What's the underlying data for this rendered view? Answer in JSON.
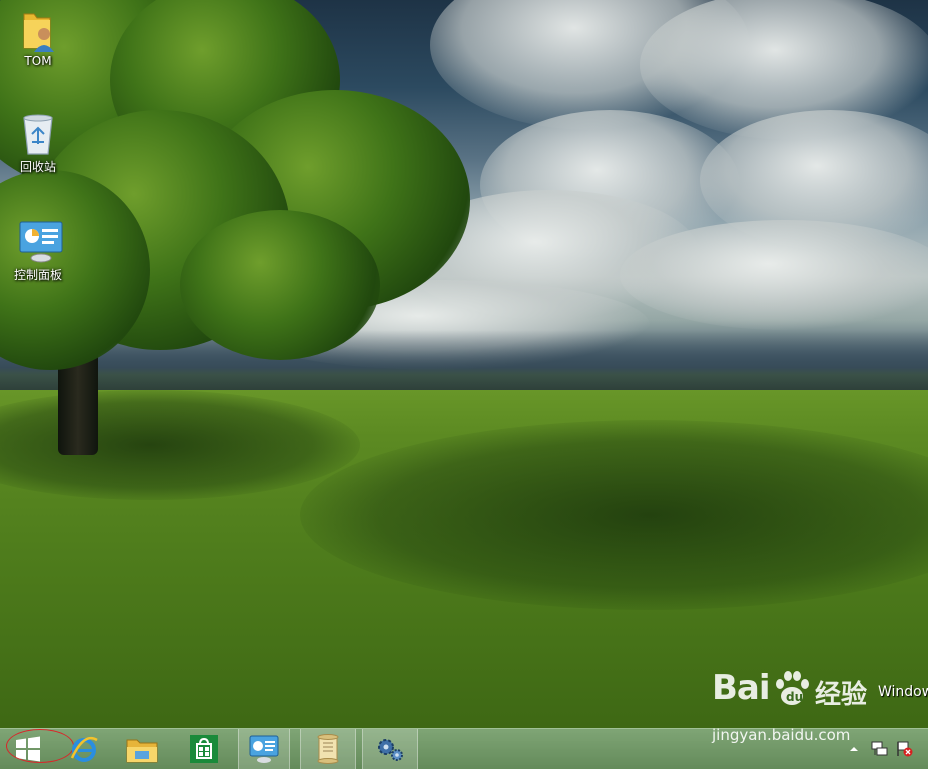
{
  "desktop": {
    "icons": [
      {
        "label": "TOM",
        "icon": "user-folder-icon"
      },
      {
        "label": "回收站",
        "icon": "recycle-bin-icon"
      },
      {
        "label": "控制面板",
        "icon": "control-panel-icon"
      }
    ],
    "windows_text": "Windows"
  },
  "watermark": {
    "brand": "Bai",
    "brand_cn": "经验",
    "url": "jingyan.baidu.com"
  },
  "taskbar": {
    "buttons": [
      {
        "name": "start-button",
        "icon": "windows-logo-icon"
      },
      {
        "name": "internet-explorer",
        "icon": "ie-icon"
      },
      {
        "name": "file-explorer",
        "icon": "folder-icon"
      },
      {
        "name": "windows-store",
        "icon": "store-icon"
      },
      {
        "name": "control-panel",
        "icon": "control-panel-icon"
      },
      {
        "name": "notepad-scroll",
        "icon": "scroll-icon"
      },
      {
        "name": "settings",
        "icon": "gear-icon"
      }
    ],
    "tray": [
      "chevron-up-icon",
      "network-icon",
      "flag-icon"
    ],
    "colors": {
      "start_highlight": "#d8262a",
      "taskbar": "#6f9764"
    }
  }
}
